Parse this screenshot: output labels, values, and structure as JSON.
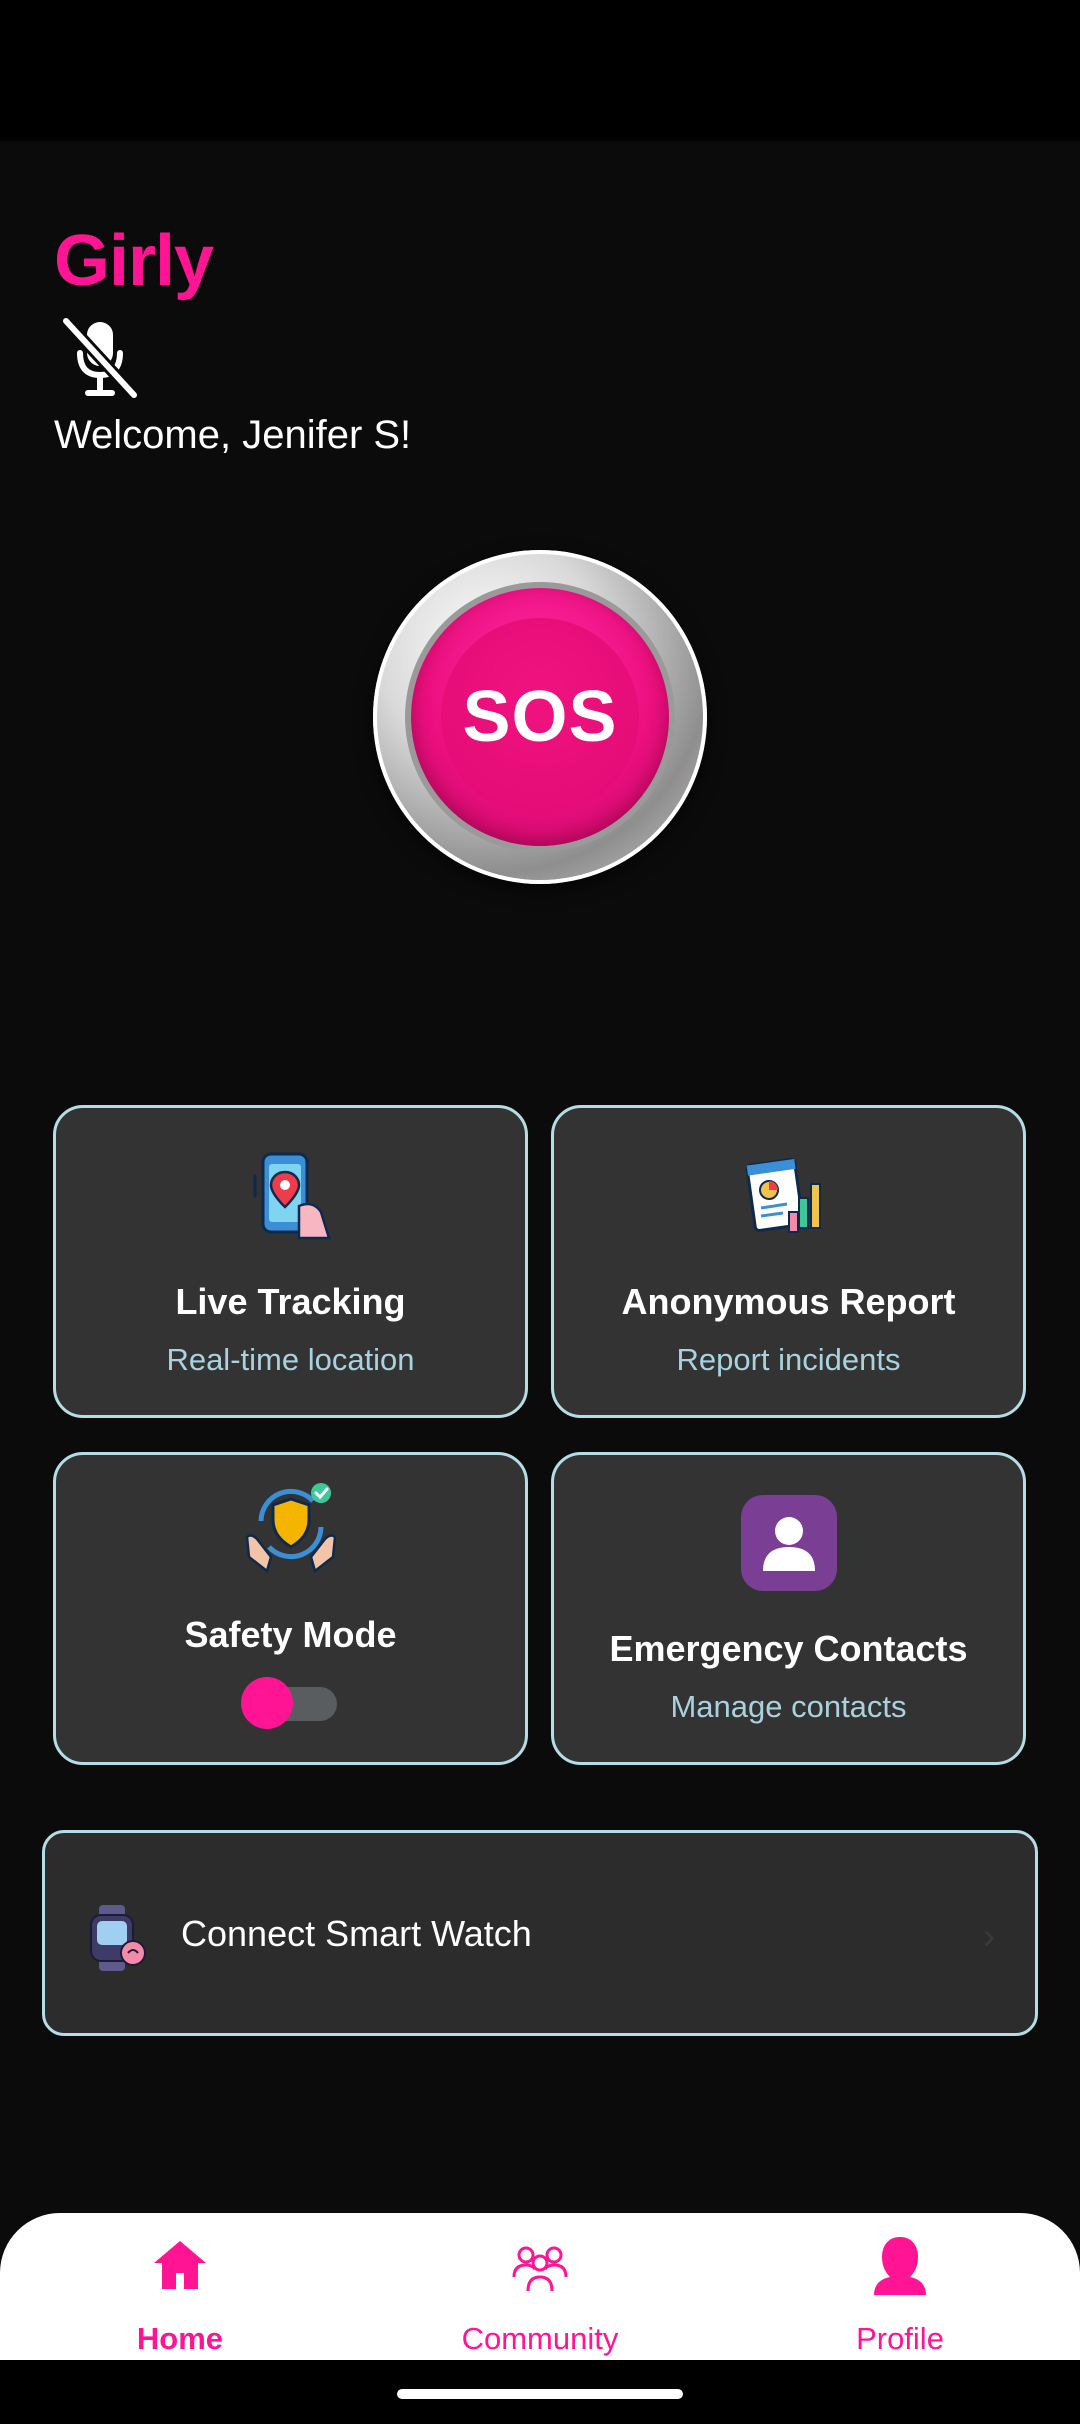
{
  "app": {
    "title": "Girly",
    "welcome": "Welcome, Jenifer S!",
    "brand_color": "#ff1493"
  },
  "sos": {
    "label": "SOS"
  },
  "cards": {
    "tracking": {
      "title": "Live Tracking",
      "subtitle": "Real-time location",
      "icon": "location-phone-icon"
    },
    "report": {
      "title": "Anonymous Report",
      "subtitle": "Report incidents",
      "icon": "report-chart-icon"
    },
    "safety": {
      "title": "Safety Mode",
      "icon": "shield-hands-icon",
      "toggle_on": true
    },
    "contacts": {
      "title": "Emergency Contacts",
      "subtitle": "Manage contacts",
      "icon": "contact-person-icon"
    }
  },
  "watch": {
    "label": "Connect Smart Watch",
    "icon": "smartwatch-icon"
  },
  "nav": {
    "items": [
      {
        "label": "Home",
        "icon": "home-icon",
        "active": true
      },
      {
        "label": "Community",
        "icon": "community-icon",
        "active": false
      },
      {
        "label": "Profile",
        "icon": "profile-icon",
        "active": false
      }
    ]
  }
}
